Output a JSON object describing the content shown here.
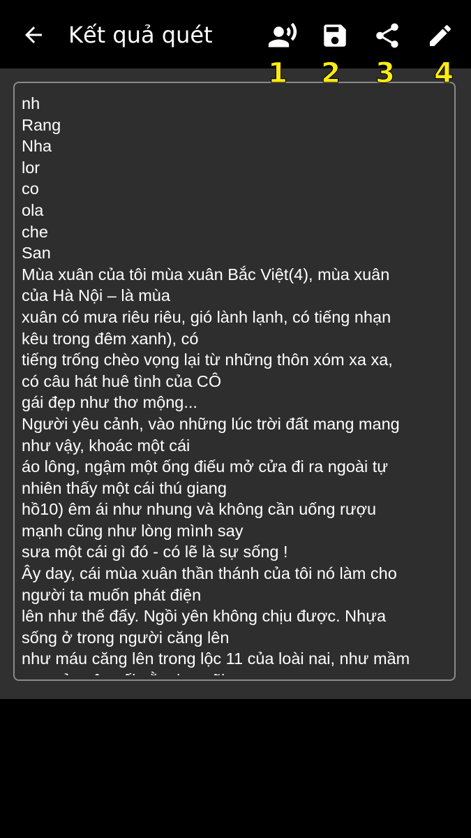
{
  "appbar": {
    "title": "Kết quả quét",
    "actions": [
      {
        "icon": "speaker-person-icon",
        "number": "1"
      },
      {
        "icon": "save-icon",
        "number": "2"
      },
      {
        "icon": "share-icon",
        "number": "3"
      },
      {
        "icon": "edit-pencil-icon",
        "number": "4"
      }
    ]
  },
  "colors": {
    "background": "#000000",
    "content": "#303030",
    "text": "#ffffff",
    "annotation": "#ffeb14",
    "border": "#8a8a8a"
  },
  "scan_text": {
    "lines": [
      "nh",
      "Rang",
      "Nha",
      "lor",
      "co",
      "ola",
      "che",
      "San",
      "Mùa xuân của tôi mùa xuân Bắc Việt(4), mùa xuân",
      "của Hà Nội – là mùa",
      "xuân có mưa riêu riêu, gió lành lạnh, có tiếng nhạn",
      "kêu trong đêm xanh), có",
      "tiếng trống chèo vọng lại từ những thôn xóm xa xa,",
      "có câu hát huê tình của CÔ",
      "gái đẹp như thơ mộng...",
      "Người yêu cảnh, vào những lúc trời đất mang mang",
      "như vậy, khoác một cái",
      "áo lông, ngậm một ống điếu mở cửa đi ra ngoài tự",
      "nhiên thấy một cái thú giang",
      "hồ10) êm ái như nhung và không cần uống rượu",
      "mạnh cũng như lòng mình say",
      "sưa một cái gì đó - có lẽ là sự sống !",
      "Ây day, cái mùa xuân thần thánh của tôi nó làm cho",
      "người ta muốn phát điện",
      "lên như thế đấy. Ngồi yên không chịu được. Nhựa",
      "sống ở trong người căng lên",
      "như máu căng lên trong lộc 11 của loài nai, như mầm",
      "non của cây cối nằm im mãi"
    ]
  }
}
